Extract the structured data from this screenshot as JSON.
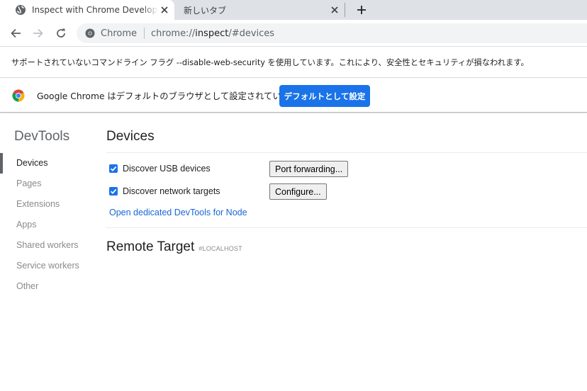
{
  "tabs": [
    {
      "title": "Inspect with Chrome Developer Tools",
      "active": true
    },
    {
      "title": "新しいタブ",
      "active": false
    }
  ],
  "toolbar": {
    "omnibox_chip": "Chrome",
    "url_scheme": "chrome://",
    "url_host": "inspect",
    "url_path": "/#devices"
  },
  "warning_bar": {
    "text": "サポートされていないコマンドライン フラグ --disable-web-security を使用しています。これにより、安全性とセキュリティが損なわれます。"
  },
  "default_bar": {
    "text": "Google Chrome はデフォルトのブラウザとして設定されていません",
    "button": "デフォルトとして設定"
  },
  "sidebar": {
    "title": "DevTools",
    "items": [
      {
        "label": "Devices"
      },
      {
        "label": "Pages"
      },
      {
        "label": "Extensions"
      },
      {
        "label": "Apps"
      },
      {
        "label": "Shared workers"
      },
      {
        "label": "Service workers"
      },
      {
        "label": "Other"
      }
    ]
  },
  "devices": {
    "title": "Devices",
    "usb_label": "Discover USB devices",
    "usb_checked": true,
    "port_forwarding_button": "Port forwarding...",
    "network_label": "Discover network targets",
    "network_checked": true,
    "configure_button": "Configure...",
    "node_link": "Open dedicated DevTools for Node"
  },
  "remote_target": {
    "title": "Remote Target",
    "subtitle": "#LOCALHOST"
  },
  "colors": {
    "accent": "#1a73e8",
    "link": "#1967d2",
    "tabstrip": "#dee1e6"
  }
}
